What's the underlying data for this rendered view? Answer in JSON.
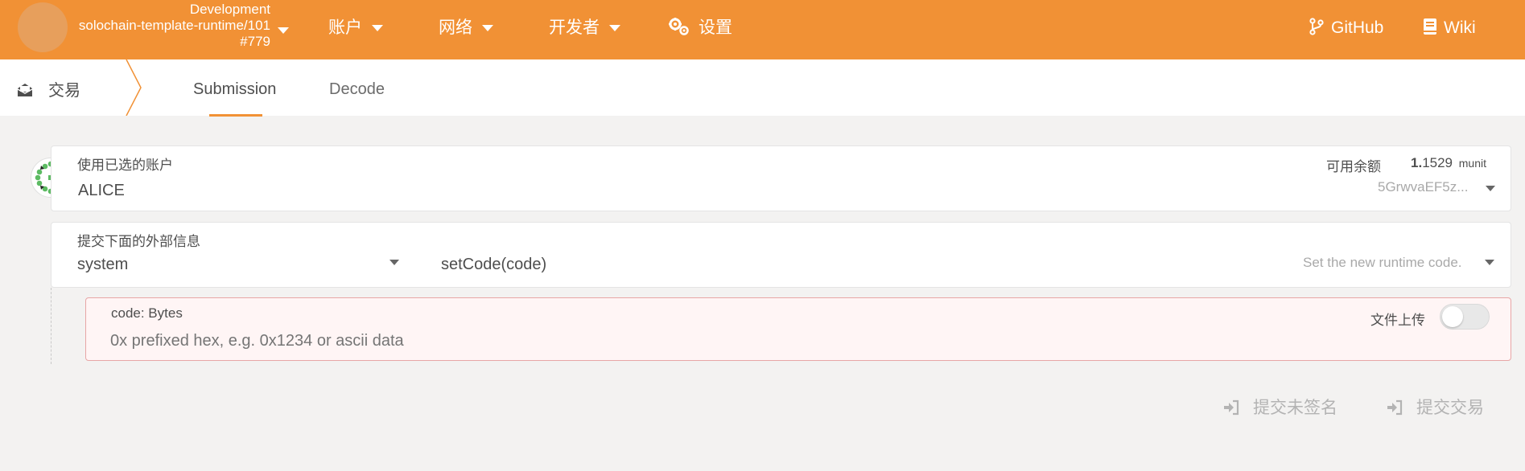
{
  "header": {
    "chain": {
      "name": "Development",
      "runtime": "solochain-template-runtime/101",
      "block": "#779"
    },
    "nav": [
      {
        "label": "账户",
        "icon": "chevron-down-icon"
      },
      {
        "label": "网络",
        "icon": "chevron-down-icon"
      },
      {
        "label": "开发者",
        "icon": "chevron-down-icon"
      },
      {
        "label": "设置",
        "icon": "gears-icon"
      }
    ],
    "links": [
      {
        "label": "GitHub",
        "icon": "code-branch-icon"
      },
      {
        "label": "Wiki",
        "icon": "book-icon"
      }
    ],
    "bg_color": "#f19135"
  },
  "subnav": {
    "section": {
      "label": "交易",
      "icon": "envelope-open-icon"
    },
    "tabs": [
      {
        "label": "Submission",
        "active": true
      },
      {
        "label": "Decode",
        "active": false
      }
    ]
  },
  "account": {
    "label": "使用已选的账户",
    "name": "ALICE",
    "balance_label": "可用余额",
    "balance_major": "1.",
    "balance_minor": "1529",
    "balance_unit": "munit",
    "address": "5GrwvaEF5z..."
  },
  "extrinsic": {
    "label": "提交下面的外部信息",
    "module": "system",
    "method": "setCode(code)",
    "description": "Set the new runtime code."
  },
  "param": {
    "label": "code: Bytes",
    "placeholder": "0x prefixed hex, e.g. 0x1234 or ascii data",
    "file_upload_label": "文件上传",
    "file_upload_on": false
  },
  "actions": [
    {
      "label": "提交未签名",
      "icon": "sign-in-icon"
    },
    {
      "label": "提交交易",
      "icon": "sign-in-icon"
    }
  ]
}
